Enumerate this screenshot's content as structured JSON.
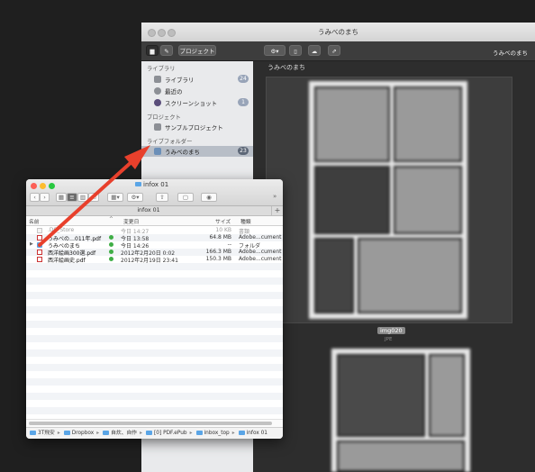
{
  "back_window": {
    "title": "うみべのまち",
    "toolbar": {
      "project_button": "プロジェクト",
      "right_title": "うみべのまち"
    },
    "sidebar": {
      "sections": [
        {
          "title": "ライブラリ",
          "items": [
            {
              "label": "ライブラリ",
              "count": "24",
              "icon": "library-icon"
            },
            {
              "label": "最近の",
              "count": "",
              "icon": "clock-icon"
            },
            {
              "label": "スクリーンショット",
              "count": "1",
              "icon": "camera-icon"
            }
          ]
        },
        {
          "title": "プロジェクト",
          "items": [
            {
              "label": "サンプルプロジェクト",
              "count": "",
              "icon": "box-icon"
            }
          ]
        },
        {
          "title": "ライブフォルダー",
          "items": [
            {
              "label": "うみべのまち",
              "count": "23",
              "icon": "folder-icon"
            }
          ]
        }
      ]
    },
    "main": {
      "breadcrumb": "うみべのまち",
      "caption": "img020",
      "subcaption": "JPE"
    }
  },
  "front_window": {
    "title": "infox 01",
    "tab_label": "infox 01",
    "columns": {
      "name": "名前",
      "date": "変更日",
      "size": "サイズ",
      "kind": "種類"
    },
    "rows": [
      {
        "name": ".DS_Store",
        "date": "今日 14:27",
        "size": "10 KB",
        "kind": "書類",
        "dim": true,
        "icon": "file"
      },
      {
        "name": "うみべの…011年.pdf",
        "date": "今日 13:58",
        "size": "64.8 MB",
        "kind": "Adobe...cument",
        "icon": "pdf",
        "synced": true
      },
      {
        "name": "うみべのまち",
        "date": "今日 14:26",
        "size": "--",
        "kind": "フォルダ",
        "icon": "folder",
        "synced": true,
        "disclosure": "▶"
      },
      {
        "name": "西洋絵画300選.pdf",
        "date": "2012年2月20日 0:02",
        "size": "166.3 MB",
        "kind": "Adobe...cument",
        "icon": "pdf",
        "synced": true
      },
      {
        "name": "西洋絵画史.pdf",
        "date": "2012年2月19日 23:41",
        "size": "150.3 MB",
        "kind": "Adobe...cument",
        "icon": "pdf",
        "synced": true
      }
    ],
    "path_bar": [
      "3T飛安",
      "Dropbox",
      "自炊、自作",
      "[0] PDF.ePub",
      "inbox_top",
      "infox 01"
    ]
  },
  "colors": {
    "arrow": "#e8402c",
    "selected_row": "#b8bec7",
    "sync_ok": "#3fae46",
    "folder": "#5aa5e6"
  }
}
